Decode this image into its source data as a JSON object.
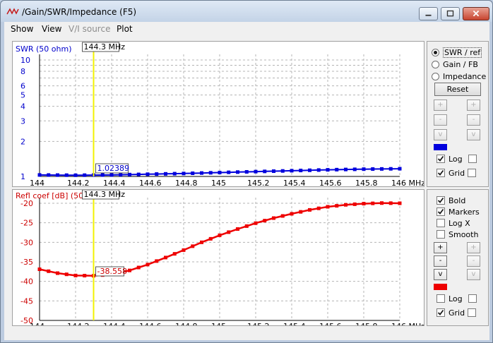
{
  "window": {
    "title": "/Gain/SWR/Impedance (F5)"
  },
  "menu": {
    "show": "Show",
    "view": "View",
    "vi_source": "V/I source",
    "plot": "Plot"
  },
  "colors": {
    "swr_trace": "#0000dd",
    "refl_trace": "#ee0000",
    "cursor": "#f2f200"
  },
  "cursor": {
    "frequency_mhz": 144.3,
    "label": "144.3 MHz"
  },
  "top_plot": {
    "ylabel": "SWR (50 ohm)",
    "y_ticks": [
      "10",
      "8",
      "6",
      "5",
      "4",
      "3",
      "2",
      "1"
    ],
    "x_ticks": [
      "144",
      "144.2",
      "144.4",
      "144.6",
      "144.8",
      "145",
      "145.2",
      "145.4",
      "145.6",
      "145.8",
      "146 MHz"
    ],
    "value_label": "1.02389"
  },
  "bottom_plot": {
    "ylabel": "Refl coef [dB] (50 ohm)",
    "ylabel_visible": "Refl coef [dB] (50",
    "y_ticks": [
      "-20",
      "-25",
      "-30",
      "-35",
      "-40",
      "-45",
      "-50"
    ],
    "x_ticks": [
      "144",
      "144.2",
      "144.4",
      "144.6",
      "144.8",
      "145",
      "145.2",
      "145.4",
      "145.6",
      "145.8",
      "146 MHz"
    ],
    "value_label": "-38.558"
  },
  "chart_data": [
    {
      "type": "line",
      "title": "",
      "xlabel": "MHz",
      "ylabel": "SWR (50 ohm)",
      "xlim": [
        144,
        146
      ],
      "ylim": [
        1,
        10
      ],
      "yscale": "log",
      "grid": true,
      "x": [
        144.0,
        144.2,
        144.4,
        144.6,
        144.8,
        145.0,
        145.2,
        145.4,
        145.6,
        145.8,
        146.0
      ],
      "series": [
        {
          "name": "",
          "values": [
            1.03,
            1.024,
            1.03,
            1.045,
            1.06,
            1.08,
            1.1,
            1.12,
            1.14,
            1.155,
            1.165
          ]
        }
      ]
    },
    {
      "type": "line",
      "title": "",
      "xlabel": "MHz",
      "ylabel": "Refl coef [dB] (50",
      "xlim": [
        144,
        146
      ],
      "ylim": [
        -50,
        -20
      ],
      "grid": true,
      "x": [
        144.0,
        144.1,
        144.2,
        144.3,
        144.4,
        144.5,
        144.6,
        144.7,
        144.8,
        144.9,
        145.0,
        145.1,
        145.2,
        145.3,
        145.4,
        145.5,
        145.6,
        145.7,
        145.8,
        145.9,
        146.0
      ],
      "series": [
        {
          "name": "",
          "values": [
            -36.9,
            -37.9,
            -38.5,
            -38.56,
            -38.2,
            -37.2,
            -35.7,
            -33.9,
            -32.0,
            -30.0,
            -28.2,
            -26.6,
            -25.1,
            -23.8,
            -22.7,
            -21.7,
            -20.9,
            -20.4,
            -20.1,
            -19.95,
            -20.0
          ]
        }
      ]
    }
  ],
  "panel_top": {
    "radio_swr": "SWR / ref",
    "radio_gain": "Gain / FB",
    "radio_impedance": "Impedance",
    "reset": "Reset",
    "selected": "swr",
    "btn_plus": "+",
    "btn_minus": "-",
    "btn_v": "v",
    "log": "Log",
    "grid": "Grid",
    "log_left_checked": true,
    "log_right_checked": false,
    "grid_left_checked": true,
    "grid_right_checked": false
  },
  "panel_bottom": {
    "bold": "Bold",
    "markers": "Markers",
    "logx": "Log X",
    "smooth": "Smooth",
    "bold_checked": true,
    "markers_checked": true,
    "logx_checked": false,
    "smooth_checked": false,
    "btn_plus": "+",
    "btn_minus": "-",
    "btn_v": "v",
    "log": "Log",
    "grid": "Grid",
    "log_left_checked": false,
    "log_right_checked": false,
    "grid_left_checked": true,
    "grid_right_checked": false
  }
}
